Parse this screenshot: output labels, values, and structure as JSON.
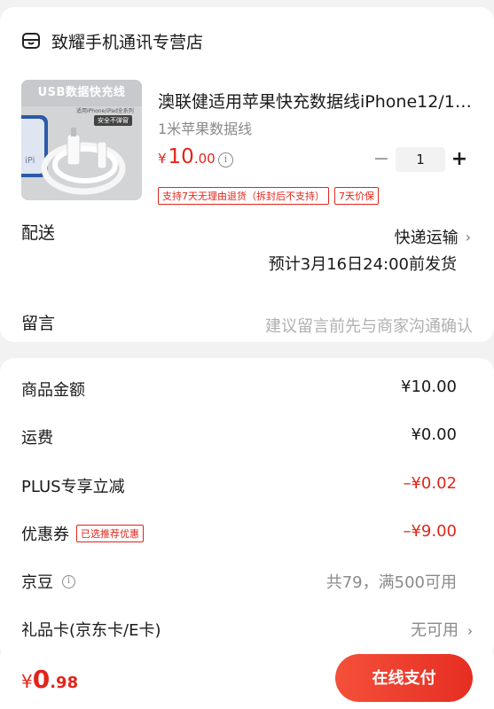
{
  "shop": {
    "name": "致耀手机通讯专营店",
    "icon": "store-icon"
  },
  "product": {
    "title": "澳联健适用苹果快充数据线iPhone12/11…",
    "spec": "1米苹果数据线",
    "price_currency": "¥",
    "price_int": "10",
    "price_dec": ".00",
    "quantity": "1",
    "qty_minus": "−",
    "qty_plus": "+",
    "info_glyph": "i",
    "tags": [
      "支持7天无理由退货（拆封后不支持）",
      "7天价保"
    ],
    "image": {
      "banner": "USB数据快充线",
      "sub": "适用iPhone/iPad全系列",
      "badge": "安全不弹窗",
      "side": "iPi"
    }
  },
  "delivery": {
    "label": "配送",
    "method": "快递运输",
    "eta": "预计3月16日24:00前发货",
    "chevron": "›"
  },
  "note": {
    "label": "留言",
    "placeholder": "建议留言前先与商家沟通确认"
  },
  "price_detail": {
    "goods": {
      "label": "商品金额",
      "value": "¥10.00"
    },
    "shipping": {
      "label": "运费",
      "value": "¥0.00"
    },
    "plus": {
      "label": "PLUS专享立减",
      "value": "–¥0.02"
    },
    "coupon": {
      "label": "优惠券",
      "tag": "已选推荐优惠",
      "value": "–¥9.00"
    },
    "jingdou": {
      "label": "京豆",
      "value": "共79，满500可用"
    },
    "giftcard": {
      "label": "礼品卡(京东卡/E卡)",
      "value": "无可用",
      "chevron": "›"
    }
  },
  "footer": {
    "total_currency": "¥",
    "total_int": "0",
    "total_dec": ".98",
    "pay_label": "在线支付"
  },
  "colors": {
    "accent": "#e1251b",
    "background": "#f2f2f2"
  }
}
